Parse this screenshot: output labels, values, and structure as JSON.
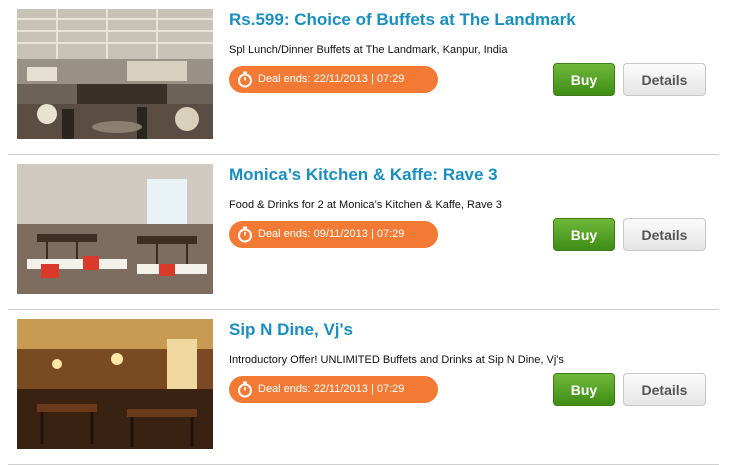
{
  "deals": [
    {
      "title": "Rs.599: Choice of Buffets at The Landmark",
      "description": "Spl Lunch/Dinner Buffets at The Landmark, Kanpur, India",
      "deal_ends": "Deal ends: 22/11/2013 | 07:29",
      "buy_label": "Buy",
      "details_label": "Details"
    },
    {
      "title": "Monica’s Kitchen & Kaffe: Rave 3",
      "description": "Food & Drinks for 2 at Monica’s Kitchen & Kaffe, Rave 3",
      "deal_ends": "Deal ends: 09/11/2013 | 07:29",
      "buy_label": "Buy",
      "details_label": "Details"
    },
    {
      "title": "Sip N Dine, Vj's",
      "description": "Introductory Offer! UNLIMITED Buffets and Drinks at Sip N Dine, Vj's",
      "deal_ends": "Deal ends: 22/11/2013 | 07:29",
      "buy_label": "Buy",
      "details_label": "Details"
    }
  ],
  "colors": {
    "title": "#1a8fbf",
    "deal_ends_badge": "#f27a35",
    "buy_button": "#4e9e22",
    "details_button": "#ededed"
  },
  "icons": {
    "deal_ends": "stopwatch-icon"
  }
}
